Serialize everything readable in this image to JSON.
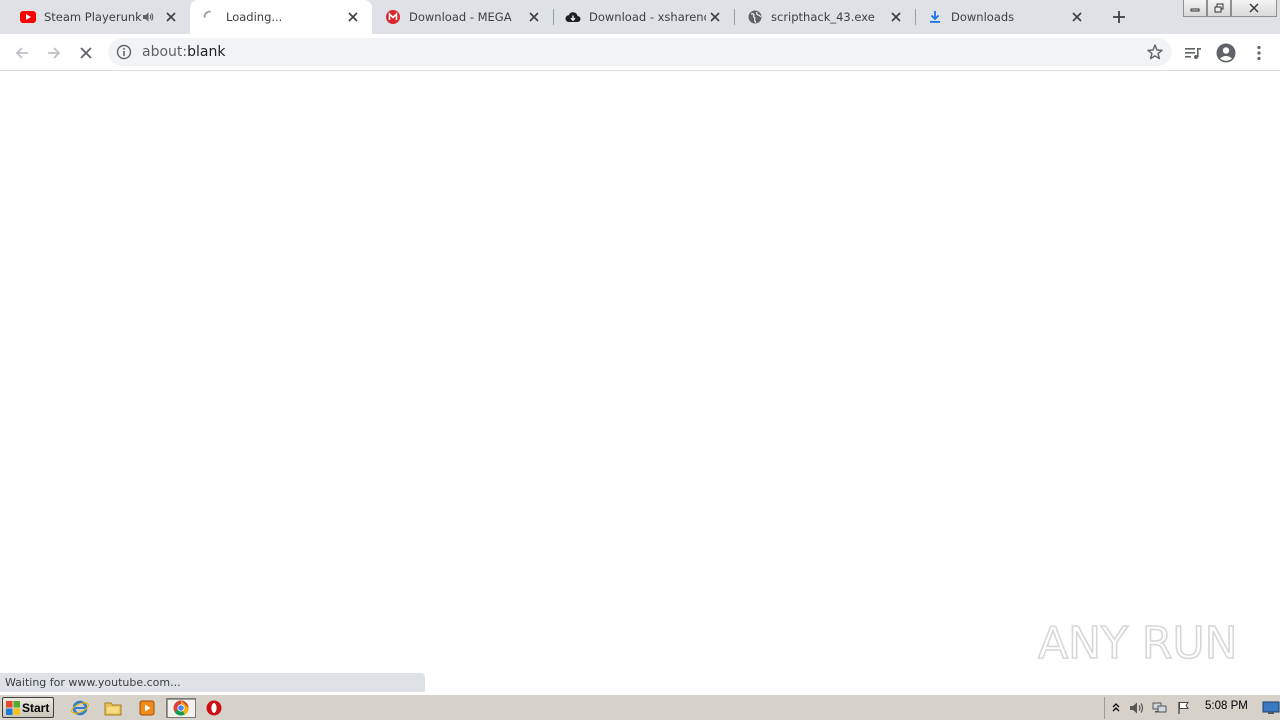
{
  "tabs": [
    {
      "title": "Steam Playerunknown's Battlegrounds",
      "favicon": "youtube-icon",
      "audible": true
    },
    {
      "title": "Loading...",
      "favicon": "loading-spinner-icon",
      "active": true
    },
    {
      "title": "Download - MEGA",
      "favicon": "mega-icon"
    },
    {
      "title": "Download - xsharenode",
      "favicon": "cloud-download-icon"
    },
    {
      "title": "scripthack_43.exe",
      "favicon": "globe-icon"
    },
    {
      "title": "Downloads",
      "favicon": "download-icon"
    }
  ],
  "omnibox": {
    "scheme": "about:",
    "rest": "blank"
  },
  "status_bubble": "Waiting for www.youtube.com...",
  "watermark": "ANY RUN",
  "taskbar": {
    "start_label": "Start",
    "clock": "5:08 PM"
  },
  "colors": {
    "youtube_red": "#ff0000",
    "mega_red": "#d9272e",
    "download_blue": "#1a73e8",
    "opera_red": "#cc0f16"
  }
}
